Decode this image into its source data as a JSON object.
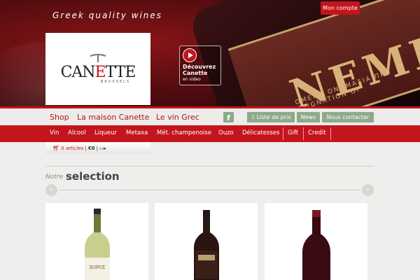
{
  "header": {
    "tagline": "Greek quality wines",
    "account_button": "Mon compte",
    "logo": {
      "word_left": "CAN",
      "word_e": "E",
      "word_right": "TTE",
      "sub": "BRUSSELS"
    },
    "video": {
      "title": "Découvrez Canette",
      "sub": "en video",
      "icon": "play-icon"
    },
    "hero_text": "ΝΕΜΕΑ",
    "hero_small": "ΟΜΕΝΗ ΟΝΟΜΑΣΙΑ ΠΡΟ",
    "hero_small2": "ESIGNATION OF"
  },
  "main_nav": {
    "items": [
      "Shop",
      "La maison Canette",
      "Le vin Grec"
    ],
    "facebook_icon": "f",
    "buttons": [
      "Liste de prix",
      "News",
      "Nous contacter"
    ],
    "list_icon": "download-icon"
  },
  "categories": [
    "Vin",
    "Alcool",
    "Liqueur",
    "Metaxa",
    "Mét. champenoise",
    "Ouzo",
    "Délicatesses",
    "Gift",
    "Credit"
  ],
  "cart": {
    "articles": "0 articles",
    "sep": "|",
    "amount": "€0",
    "sep2": "|"
  },
  "selection": {
    "prefix": "Notre",
    "title": "selection",
    "prev": "‹",
    "next": "›"
  },
  "products": [
    {
      "type": "white-wine",
      "label_text": "ΧΟΡΟΣ"
    },
    {
      "type": "red-wine-dark",
      "label_text": ""
    },
    {
      "type": "red-wine",
      "label_text": ""
    }
  ],
  "colors": {
    "brand_red": "#c3151b",
    "nav_green": "#8ea98c"
  }
}
